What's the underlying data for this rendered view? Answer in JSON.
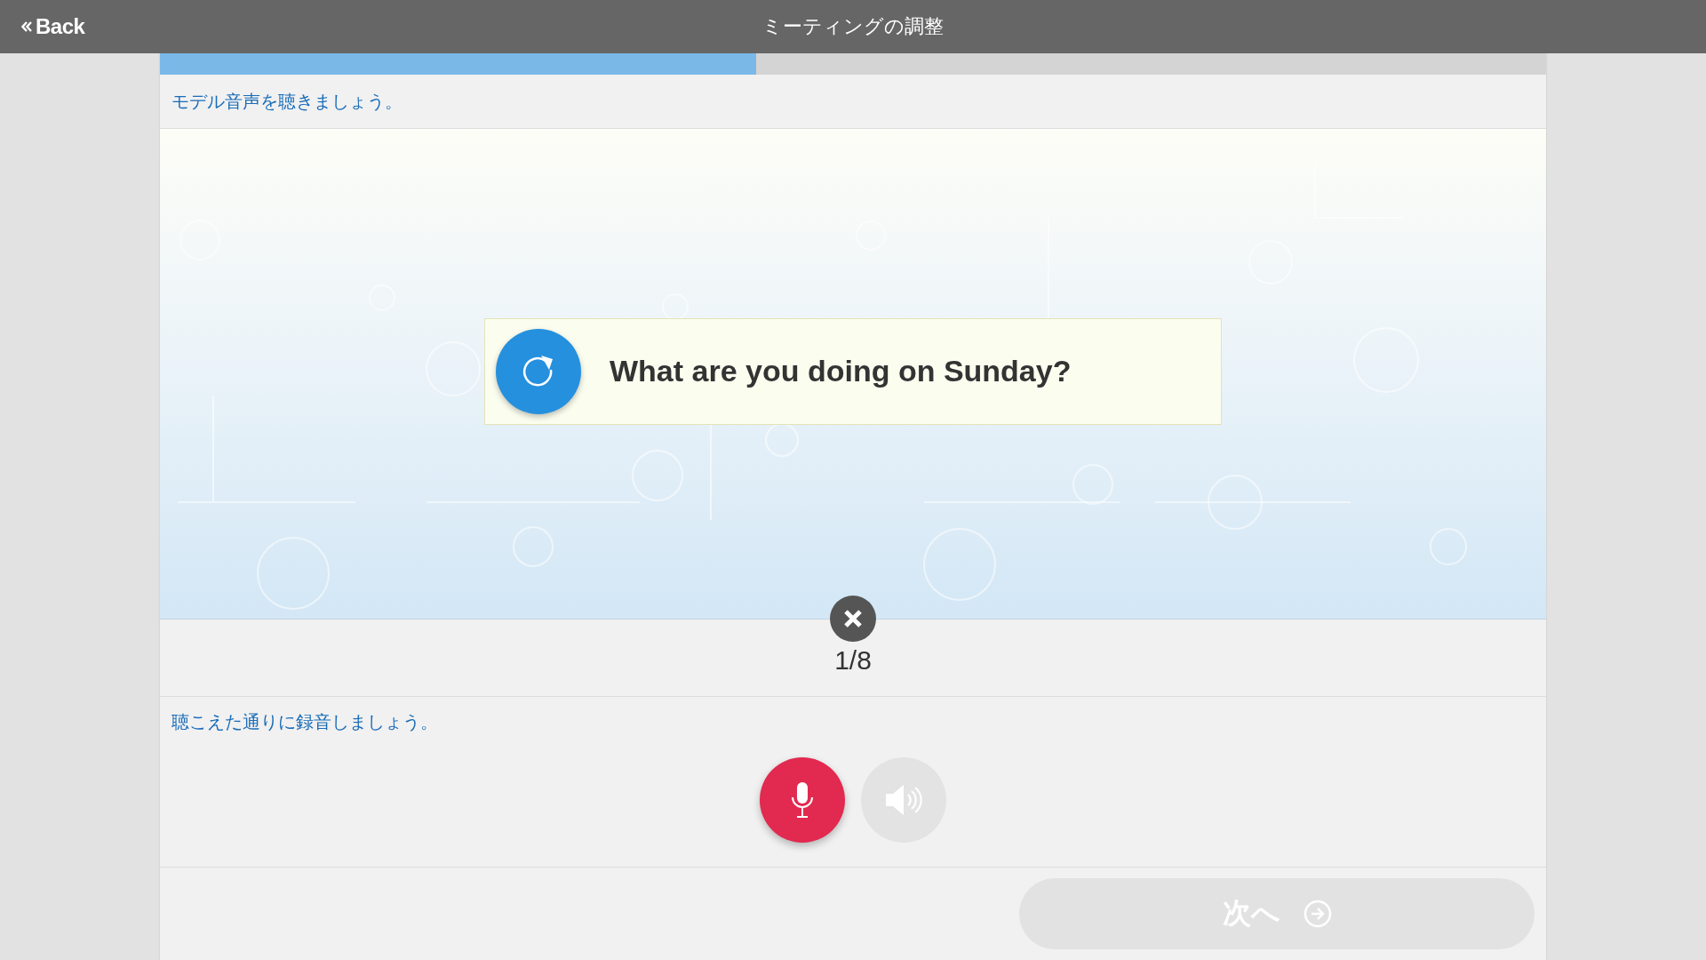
{
  "header": {
    "back_label": "Back",
    "title": "ミーティングの調整"
  },
  "progress": {
    "level": 0.43
  },
  "listen_instruction": "モデル音声を聴きましょう。",
  "prompt_card": {
    "text": "What are you doing on Sunday?"
  },
  "counter": "1/8",
  "record_instruction": "聴こえた通りに録音しましょう。",
  "controls": {
    "record_active": true,
    "playback_disabled": true
  },
  "next_button": {
    "label": "次へ",
    "disabled": true
  }
}
